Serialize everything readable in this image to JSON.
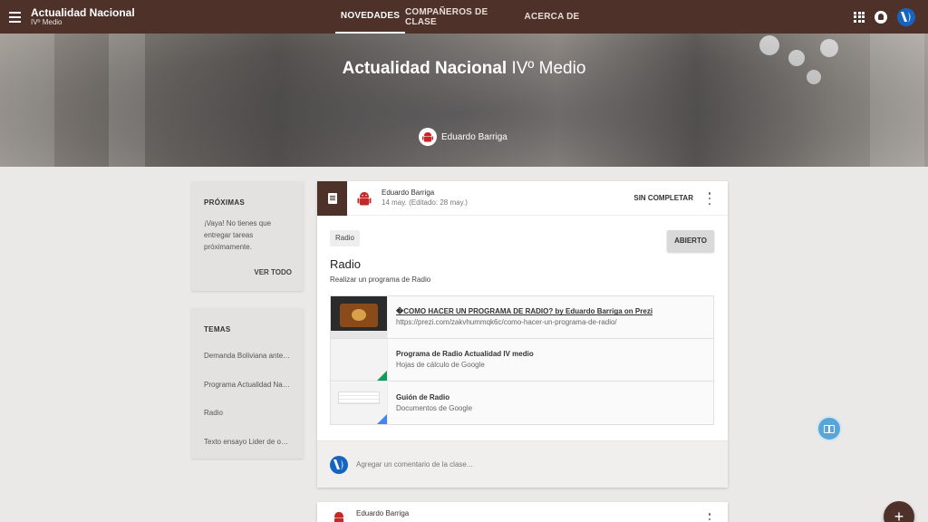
{
  "topbar": {
    "class_name": "Actualidad Nacional",
    "class_section": "IVº Medio",
    "tabs": [
      {
        "label": "NOVEDADES"
      },
      {
        "label": "COMPAÑEROS DE CLASE"
      },
      {
        "label": "ACERCA DE"
      }
    ]
  },
  "banner": {
    "title_bold": "Actualidad Nacional",
    "title_light": "IVº Medio",
    "teacher": "Eduardo Barriga"
  },
  "upcoming": {
    "heading": "PRÓXIMAS",
    "message": "¡Vaya! No tienes que entregar tareas próximamente.",
    "see_all": "VER TODO"
  },
  "topics": {
    "heading": "TEMAS",
    "items": [
      {
        "label": "Demanda Boliviana ante La Haya"
      },
      {
        "label": "Programa Actualidad Nacional"
      },
      {
        "label": "Radio"
      },
      {
        "label": "Texto ensayo Lider de opinión"
      }
    ]
  },
  "post": {
    "author": "Eduardo Barriga",
    "date": "14 may. (Editado: 28 may.)",
    "status": "SIN COMPLETAR",
    "topic_chip": "Radio",
    "open_button": "ABIERTO",
    "title": "Radio",
    "description": "Realizar un programa de Radio",
    "attachments": [
      {
        "title": "�COMO HACER UN PROGRAMA DE RADIO? by Eduardo Barriga on Prezi",
        "subtitle": "https://prezi.com/zakvhummqk6c/como-hacer-un-programa-de-radio/"
      },
      {
        "title": "Programa de Radio Actualidad IV medio",
        "subtitle": "Hojas de cálculo de Google"
      },
      {
        "title": "Guión de Radio",
        "subtitle": "Documentos de Google"
      }
    ],
    "comment_placeholder": "Agregar un comentario de la clase..."
  },
  "post2": {
    "author": "Eduardo Barriga"
  },
  "fab_label": "+",
  "colors": {
    "theme": "#4e3229",
    "page_bg": "#ebe9e8",
    "sheets_green": "#0f9d58",
    "docs_blue": "#4285f4"
  },
  "icons": [
    "menu-icon",
    "apps-grid-icon",
    "notifications-icon",
    "profile-logo-icon",
    "assignment-icon",
    "android-avatar-icon",
    "more-vert-icon",
    "help-book-icon",
    "add-icon"
  ]
}
